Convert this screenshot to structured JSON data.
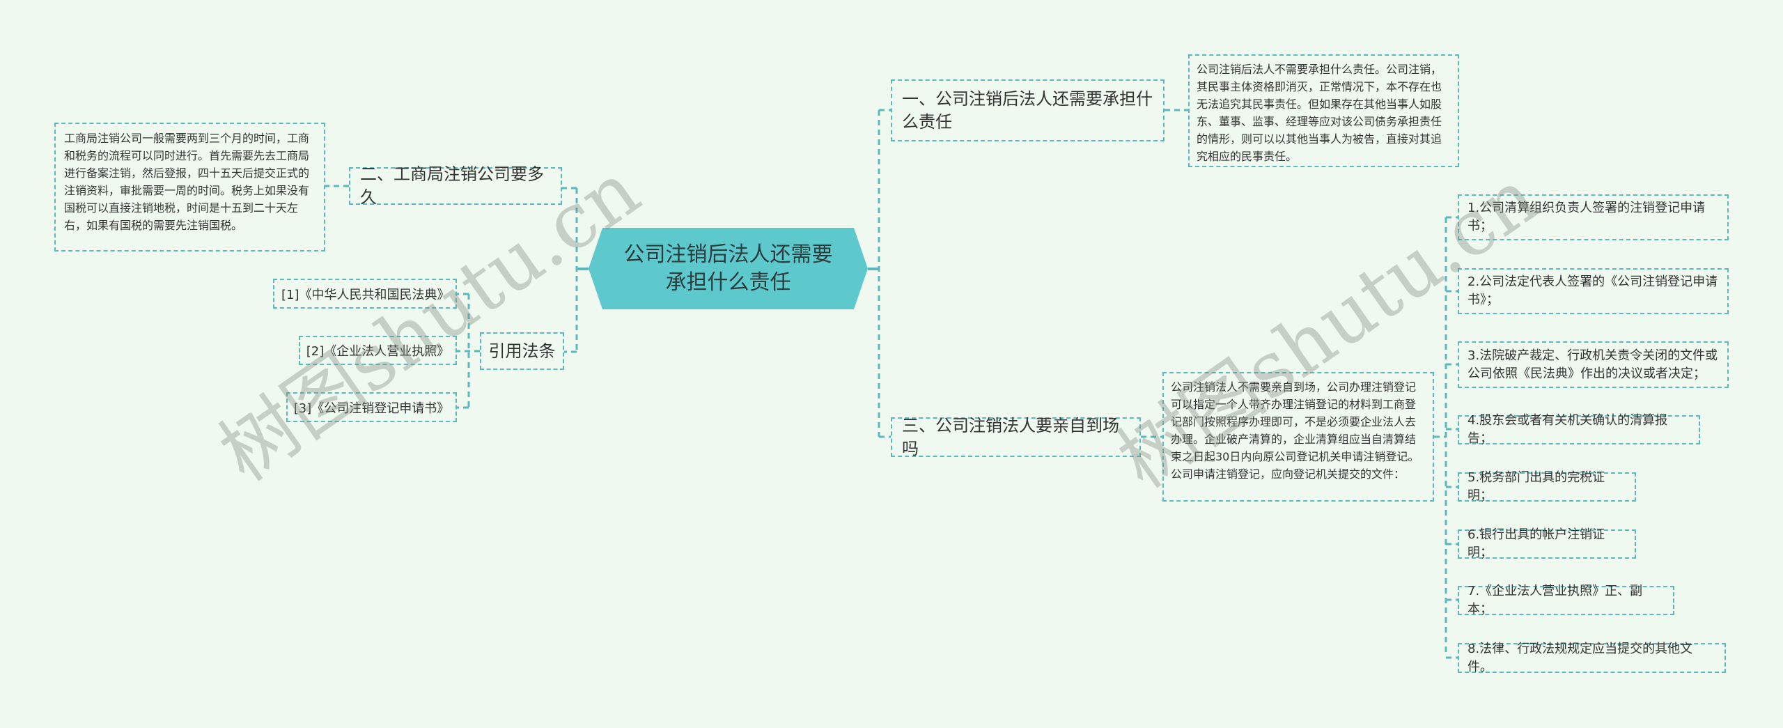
{
  "center": {
    "title": "公司注销后法人还需要承担什么责任"
  },
  "left": {
    "branch2": {
      "title": "二、工商局注销公司要多久",
      "detail": "工商局注销公司一般需要两到三个月的时间，工商和税务的流程可以同时进行。首先需要先去工商局进行备案注销，然后登报，四十五天后提交正式的注销资料，审批需要一周的时间。税务上如果没有国税可以直接注销地税，时间是十五到二十天左右，如果有国税的需要先注销国税。"
    },
    "references": {
      "title": "引用法条",
      "items": [
        "[1]《中华人民共和国民法典》",
        "[2]《企业法人营业执照》",
        "[3]《公司注销登记申请书》"
      ]
    }
  },
  "right": {
    "branch1": {
      "title": "一、公司注销后法人还需要承担什么责任",
      "detail": "公司注销后法人不需要承担什么责任。公司注销，其民事主体资格即消灭，正常情况下，本不存在也无法追究其民事责任。但如果存在其他当事人如股东、董事、监事、经理等应对该公司债务承担责任的情形，则可以以其他当事人为被告，直接对其追究相应的民事责任。"
    },
    "branch3": {
      "title": "三、公司注销法人要亲自到场吗",
      "detail": "公司注销法人不需要亲自到场，公司办理注销登记可以指定一个人带齐办理注销登记的材料到工商登记部门按照程序办理即可，不是必须要企业法人去办理。企业破产清算的，企业清算组应当自清算结束之日起30日内向原公司登记机关申请注销登记。公司申请注销登记，应向登记机关提交的文件：",
      "documents": [
        "1.公司清算组织负责人签署的注销登记申请书；",
        "2.公司法定代表人签署的《公司注销登记申请书》；",
        "3.法院破产裁定、行政机关责令关闭的文件或公司依照《民法典》作出的决议或者决定；",
        "4.股东会或者有关机关确认的清算报告；",
        "5.税务部门出具的完税证明；",
        "6.银行出具的帐户注销证明；",
        "7.《企业法人营业执照》正、副本；",
        "8.法律、行政法规规定应当提交的其他文件。"
      ]
    }
  },
  "watermarks": [
    "树图shutu.cn",
    "树图shutu.cn"
  ],
  "colors": {
    "background": "#eff9ef",
    "center_fill": "#5dc9cc",
    "connector": "#5cb8bf"
  }
}
